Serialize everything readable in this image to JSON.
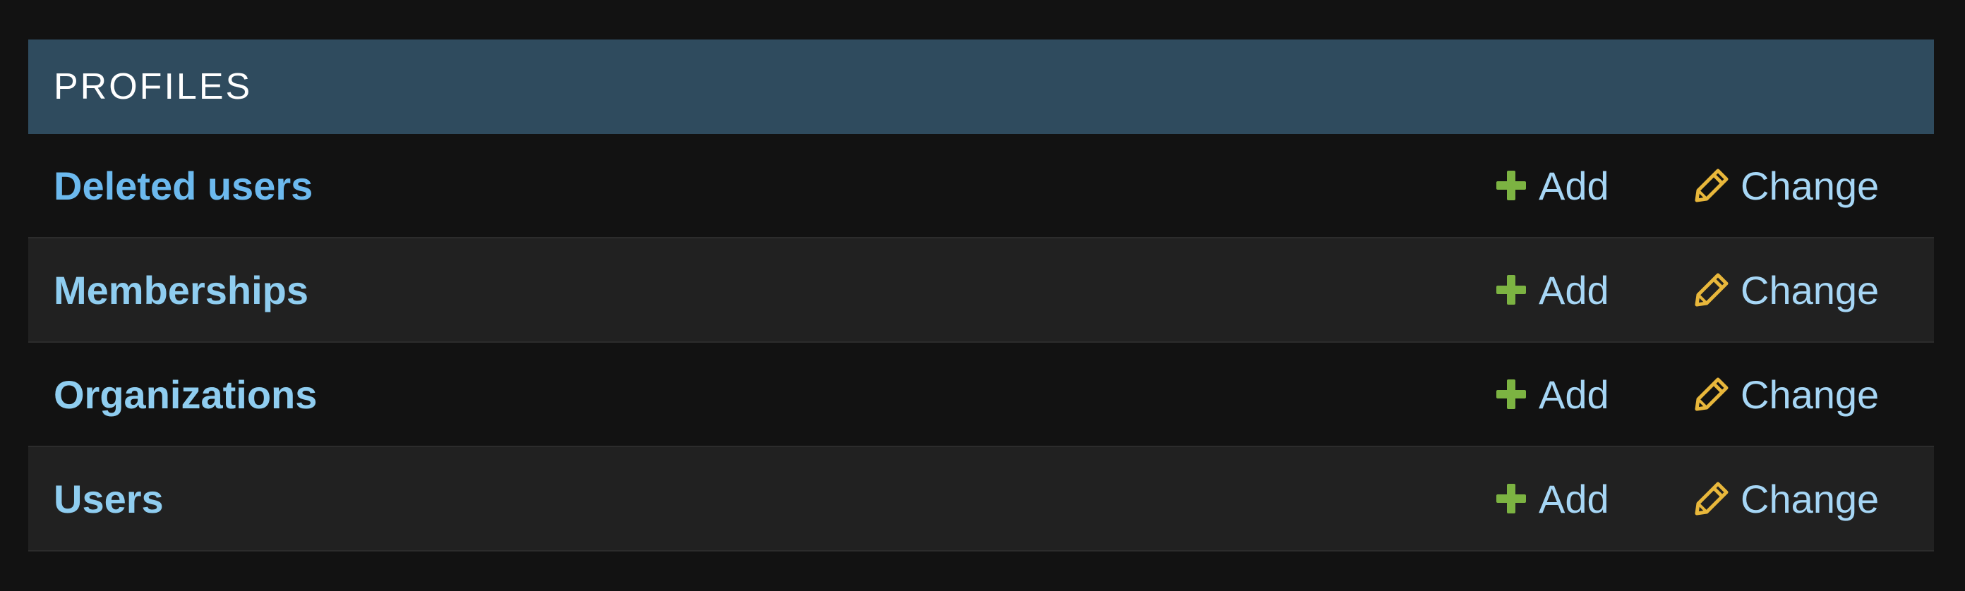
{
  "module": {
    "caption": "PROFILES",
    "rows": [
      {
        "label": "Deleted users",
        "add_label": "Add",
        "change_label": "Change"
      },
      {
        "label": "Memberships",
        "add_label": "Add",
        "change_label": "Change"
      },
      {
        "label": "Organizations",
        "add_label": "Add",
        "change_label": "Change"
      },
      {
        "label": "Users",
        "add_label": "Add",
        "change_label": "Change"
      }
    ]
  },
  "icons": {
    "add": "plus-icon",
    "change": "pencil-icon"
  },
  "colors": {
    "caption_bg": "#2f4b5e",
    "link": "#8fcdf0",
    "add_icon": "#7cb342",
    "change_icon": "#e8b73b"
  }
}
